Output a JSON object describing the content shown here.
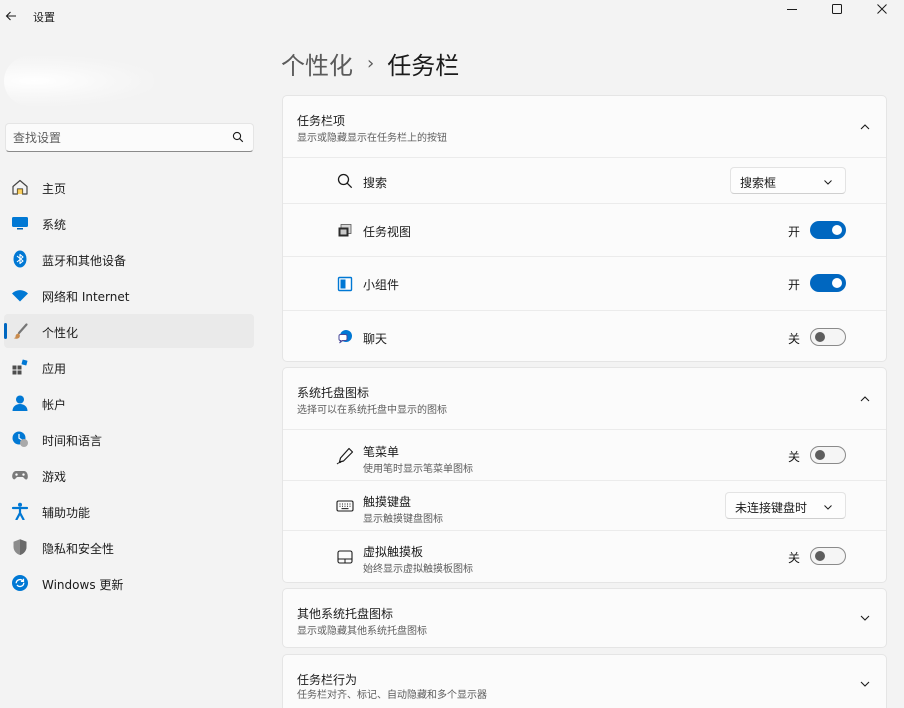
{
  "window": {
    "title": "设置",
    "back_icon": "back-arrow-icon",
    "controls": [
      "minimize-icon",
      "maximize-icon",
      "close-icon"
    ]
  },
  "search": {
    "placeholder": "查找设置",
    "value": ""
  },
  "sidebar": {
    "items": [
      {
        "label": "主页",
        "icon": "home-icon"
      },
      {
        "label": "系统",
        "icon": "system-icon"
      },
      {
        "label": "蓝牙和其他设备",
        "icon": "bluetooth-icon"
      },
      {
        "label": "网络和 Internet",
        "icon": "wifi-icon"
      },
      {
        "label": "个性化",
        "icon": "brush-icon",
        "active": true
      },
      {
        "label": "应用",
        "icon": "apps-icon"
      },
      {
        "label": "帐户",
        "icon": "account-icon"
      },
      {
        "label": "时间和语言",
        "icon": "time-language-icon"
      },
      {
        "label": "游戏",
        "icon": "gamepad-icon"
      },
      {
        "label": "辅助功能",
        "icon": "accessibility-icon"
      },
      {
        "label": "隐私和安全性",
        "icon": "shield-icon"
      },
      {
        "label": "Windows 更新",
        "icon": "update-icon"
      }
    ]
  },
  "breadcrumb": {
    "parent": "个性化",
    "separator": "›",
    "current": "任务栏"
  },
  "sections": {
    "taskbar_items": {
      "title": "任务栏项",
      "description": "显示或隐藏显示在任务栏上的按钮",
      "rows": {
        "search": {
          "label": "搜索",
          "dropdown_value": "搜索框"
        },
        "task_view": {
          "label": "任务视图",
          "state": "开",
          "on": true
        },
        "widgets": {
          "label": "小组件",
          "state": "开",
          "on": true
        },
        "chat": {
          "label": "聊天",
          "state": "关",
          "on": false
        }
      }
    },
    "system_tray": {
      "title": "系统托盘图标",
      "description": "选择可以在系统托盘中显示的图标",
      "rows": {
        "pen_menu": {
          "label": "笔菜单",
          "sub": "使用笔时显示笔菜单图标",
          "state": "关",
          "on": false
        },
        "touch_keyboard": {
          "label": "触摸键盘",
          "sub": "显示触摸键盘图标",
          "dropdown_value": "未连接键盘时"
        },
        "virtual_touchpad": {
          "label": "虚拟触摸板",
          "sub": "始终显示虚拟触摸板图标",
          "state": "关",
          "on": false
        }
      }
    },
    "other_tray": {
      "title": "其他系统托盘图标",
      "description": "显示或隐藏其他系统托盘图标"
    },
    "behaviors": {
      "title": "任务栏行为",
      "description": "任务栏对齐、标记、自动隐藏和多个显示器"
    }
  },
  "colors": {
    "accent": "#0067c0",
    "background": "#f3f3f3",
    "card": "#fbfbfb"
  }
}
